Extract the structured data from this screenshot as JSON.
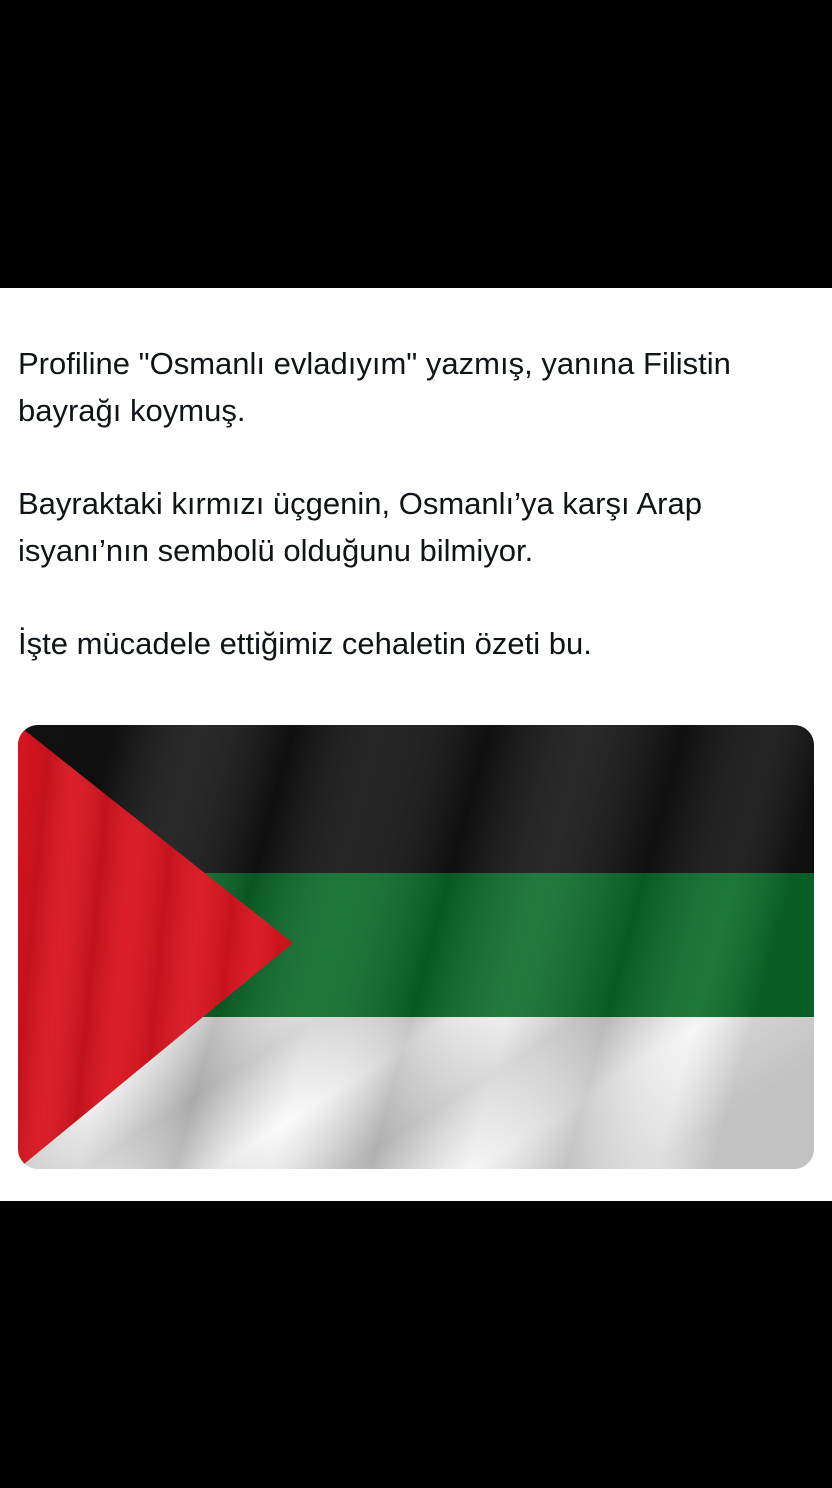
{
  "post": {
    "paragraphs": [
      "Profiline \"Osmanlı evladıyım\" yazmış, yanına Filistin bayrağı koymuş.",
      "Bayraktaki kırmızı üçgenin, Osmanlı’ya karşı Arap isyanı’nın sembolü olduğunu bilmiyor.",
      "İşte mücadele ettiğimiz cehaletin özeti bu."
    ],
    "media": {
      "icon": "palestinian-flag-image",
      "colors": {
        "black": "#121212",
        "green": "#0b6b2a",
        "white": "#f2f2f2",
        "red": "#d8141f"
      }
    }
  },
  "colors": {
    "background": "#000000",
    "card": "#ffffff",
    "text": "#0f1419"
  }
}
